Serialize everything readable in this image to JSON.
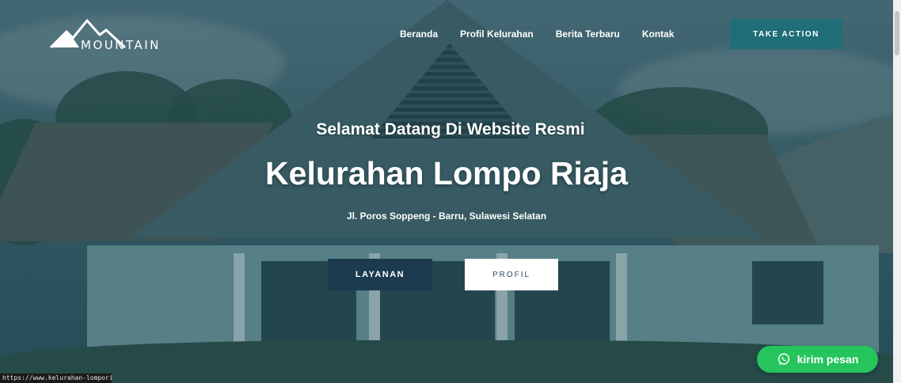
{
  "brand": {
    "name": "MOUNTAIN",
    "logo_icon": "mountain-peaks-icon"
  },
  "nav": {
    "items": [
      {
        "label": "Beranda"
      },
      {
        "label": "Profil Kelurahan"
      },
      {
        "label": "Berita Terbaru"
      },
      {
        "label": "Kontak"
      }
    ],
    "cta_label": "TAKE ACTION"
  },
  "hero": {
    "subtitle": "Selamat Datang Di Website Resmi",
    "title": "Kelurahan Lompo Riaja",
    "address": "Jl. Poros Soppeng - Barru, Sulawesi Selatan",
    "primary_button": "LAYANAN",
    "secondary_button": "PROFIL"
  },
  "whatsapp": {
    "label": "kirim pesan",
    "icon": "whatsapp-icon",
    "color": "#25c45c"
  },
  "status_bar": {
    "url": "https://www.kelurahan-lomporiaja.go.id/"
  },
  "colors": {
    "cta": "#1f6e78",
    "primary_button": "#1c3b4e",
    "secondary_button": "#ffffff"
  }
}
